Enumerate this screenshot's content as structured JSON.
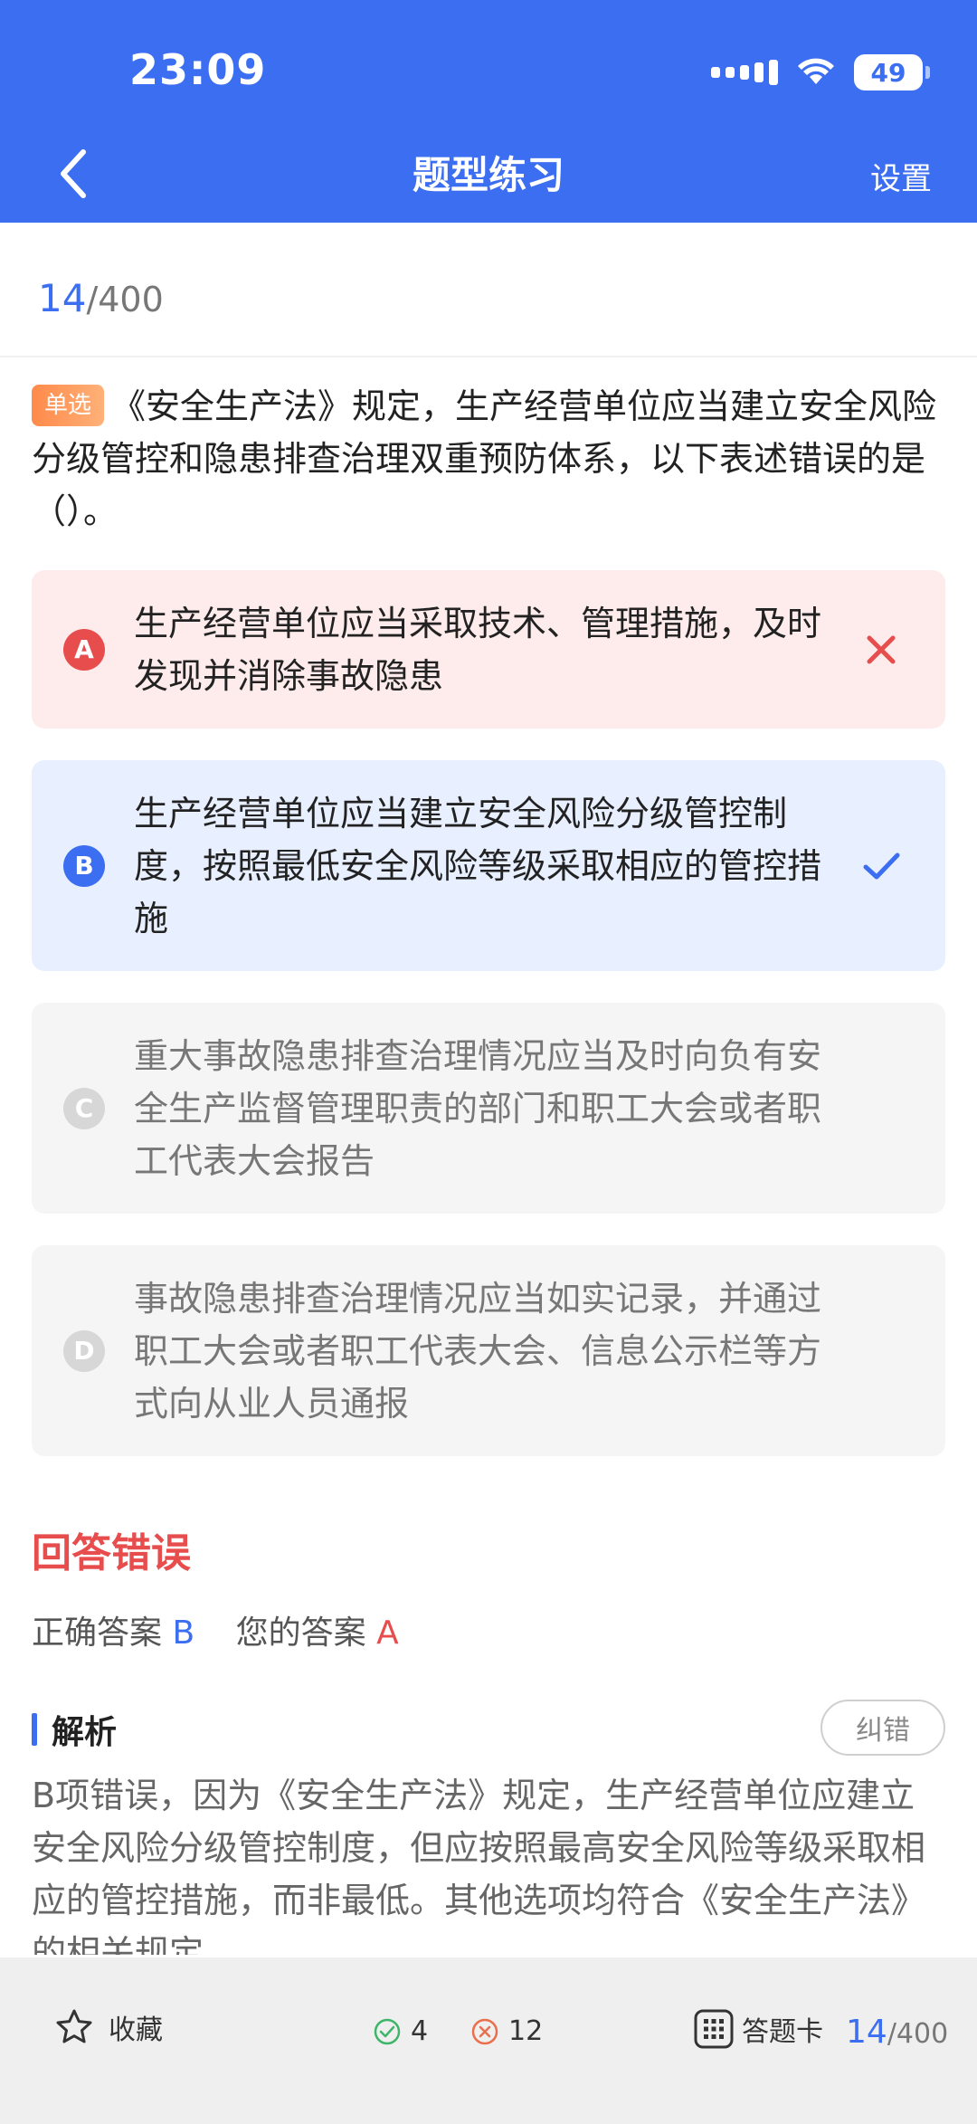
{
  "status_bar": {
    "time": "23:09",
    "battery": "49"
  },
  "nav": {
    "title": "题型练习",
    "settings": "设置"
  },
  "progress": {
    "current": "14",
    "total": "/400"
  },
  "question": {
    "tag": "单选",
    "text": "《安全生产法》规定，生产经营单位应当建立安全风险分级管控和隐患排查治理双重预防体系，以下表述错误的是（）。"
  },
  "options": [
    {
      "letter": "A",
      "text": "生产经营单位应当采取技术、管理措施，及时发现并消除事故隐患",
      "state": "wrong"
    },
    {
      "letter": "B",
      "text": "生产经营单位应当建立安全风险分级管控制度，按照最低安全风险等级采取相应的管控措施",
      "state": "correct"
    },
    {
      "letter": "C",
      "text": "重大事故隐患排查治理情况应当及时向负有安全生产监督管理职责的部门和职工大会或者职工代表大会报告",
      "state": "neutral"
    },
    {
      "letter": "D",
      "text": "事故隐患排查治理情况应当如实记录，并通过职工大会或者职工代表大会、信息公示栏等方式向从业人员通报",
      "state": "neutral"
    }
  ],
  "result": {
    "title": "回答错误",
    "correct_label": "正确答案",
    "correct_value": "B",
    "yours_label": "您的答案",
    "yours_value": "A"
  },
  "analysis": {
    "label": "解析",
    "report_button": "纠错",
    "text": "B项错误，因为《安全生产法》规定，生产经营单位应建立安全风险分级管控制度，但应按照最高安全风险等级采取相应的管控措施，而非最低。其他选项均符合《安全生产法》的相关规定。"
  },
  "bottom": {
    "favorite": "收藏",
    "right_count": "4",
    "wrong_count": "12",
    "answer_card": "答题卡",
    "progress_current": "14",
    "progress_total": "/400"
  },
  "colors": {
    "primary": "#3b6ef0",
    "error": "#e84d4d",
    "success": "#3fb56a",
    "tag": "#ff8a4a"
  }
}
